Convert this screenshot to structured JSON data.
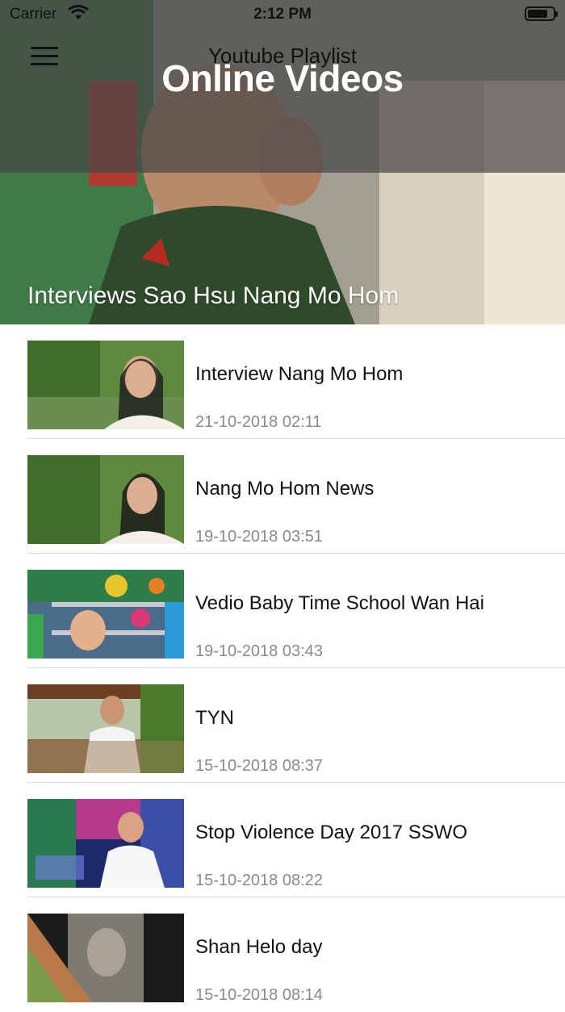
{
  "status_bar": {
    "carrier": "Carrier",
    "time": "2:12 PM"
  },
  "nav": {
    "title": "Youtube Playlist",
    "menu_icon": "hamburger-menu-icon"
  },
  "hero": {
    "overlay_title": "Online Videos",
    "caption": "Interviews Sao Hsu Nang Mo Hom"
  },
  "videos": [
    {
      "title": "Interview Nang Mo Hom",
      "date": "21-10-2018 02:11"
    },
    {
      "title": "Nang Mo Hom News",
      "date": "19-10-2018 03:51"
    },
    {
      "title": "Vedio Baby Time School Wan Hai",
      "date": "19-10-2018 03:43"
    },
    {
      "title": "TYN",
      "date": "15-10-2018 08:37"
    },
    {
      "title": "Stop Violence Day 2017 SSWO",
      "date": "15-10-2018 08:22"
    },
    {
      "title": "Shan Helo day",
      "date": "15-10-2018 08:14"
    }
  ],
  "colors": {
    "nav_overlay": "#464646",
    "divider": "#d8d8d8",
    "date_text": "#8a8a8a"
  }
}
